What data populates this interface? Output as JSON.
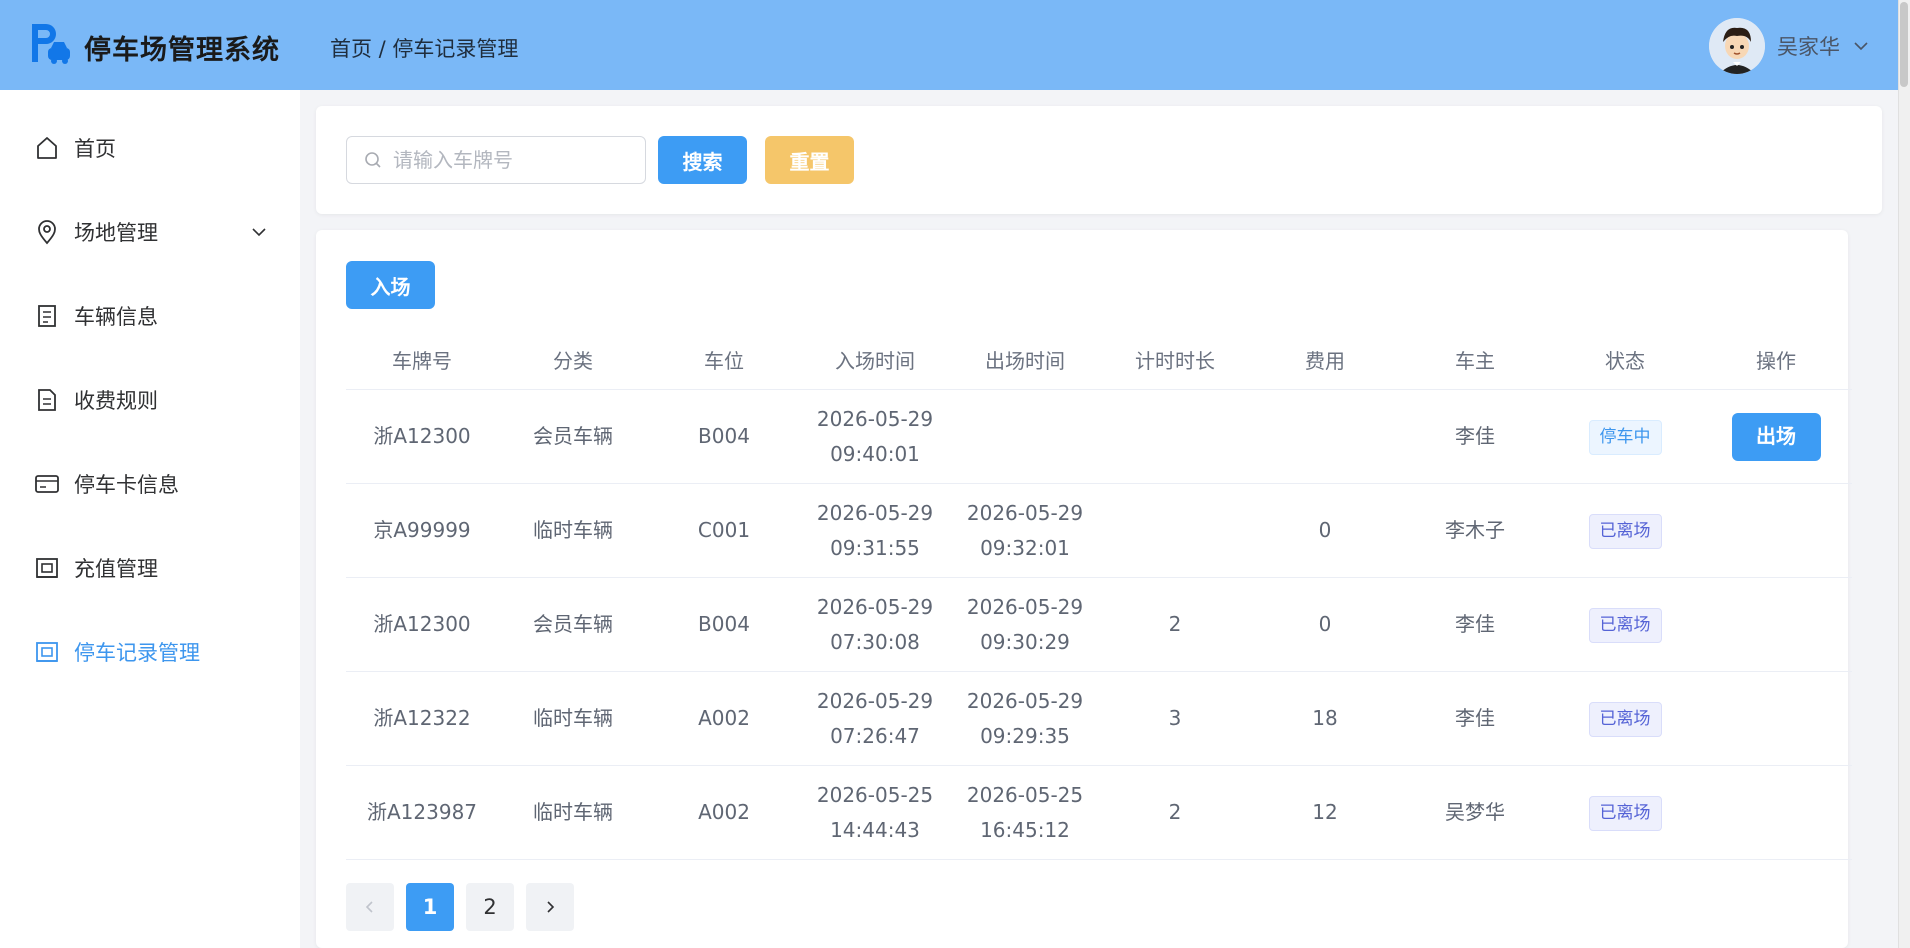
{
  "app": {
    "title": "停车场管理系统"
  },
  "breadcrumb": "首页 / 停车记录管理",
  "user": {
    "name": "吴家华"
  },
  "sidebar": {
    "items": [
      {
        "label": "首页",
        "icon": "home-icon"
      },
      {
        "label": "场地管理",
        "icon": "location-icon",
        "expandable": true
      },
      {
        "label": "车辆信息",
        "icon": "document-icon"
      },
      {
        "label": "收费规则",
        "icon": "document-icon"
      },
      {
        "label": "停车卡信息",
        "icon": "credit-card-icon"
      },
      {
        "label": "充值管理",
        "icon": "wallet-icon"
      },
      {
        "label": "停车记录管理",
        "icon": "wallet-icon",
        "active": true
      }
    ]
  },
  "search": {
    "placeholder": "请输入车牌号",
    "value": "",
    "search_label": "搜索",
    "reset_label": "重置"
  },
  "toolbar": {
    "enter_label": "入场"
  },
  "table": {
    "columns": [
      "车牌号",
      "分类",
      "车位",
      "入场时间",
      "出场时间",
      "计时时长",
      "费用",
      "车主",
      "状态",
      "操作"
    ],
    "rows": [
      {
        "plate": "浙A12300",
        "category": "会员车辆",
        "space": "B004",
        "in_date": "2026-05-29",
        "in_time": "09:40:01",
        "out_date": "",
        "out_time": "",
        "duration": "",
        "fee": "",
        "owner": "李佳",
        "status": "停车中",
        "action": "出场"
      },
      {
        "plate": "京A99999",
        "category": "临时车辆",
        "space": "C001",
        "in_date": "2026-05-29",
        "in_time": "09:31:55",
        "out_date": "2026-05-29",
        "out_time": "09:32:01",
        "duration": "",
        "fee": "0",
        "owner": "李木子",
        "status": "已离场",
        "action": ""
      },
      {
        "plate": "浙A12300",
        "category": "会员车辆",
        "space": "B004",
        "in_date": "2026-05-29",
        "in_time": "07:30:08",
        "out_date": "2026-05-29",
        "out_time": "09:30:29",
        "duration": "2",
        "fee": "0",
        "owner": "李佳",
        "status": "已离场",
        "action": ""
      },
      {
        "plate": "浙A12322",
        "category": "临时车辆",
        "space": "A002",
        "in_date": "2026-05-29",
        "in_time": "07:26:47",
        "out_date": "2026-05-29",
        "out_time": "09:29:35",
        "duration": "3",
        "fee": "18",
        "owner": "李佳",
        "status": "已离场",
        "action": ""
      },
      {
        "plate": "浙A123987",
        "category": "临时车辆",
        "space": "A002",
        "in_date": "2026-05-25",
        "in_time": "14:44:43",
        "out_date": "2026-05-25",
        "out_time": "16:45:12",
        "duration": "2",
        "fee": "12",
        "owner": "吴梦华",
        "status": "已离场",
        "action": ""
      }
    ]
  },
  "pagination": {
    "pages": [
      "1",
      "2"
    ],
    "current": "1"
  },
  "colors": {
    "header": "#7ab8f7",
    "primary": "#3d9cf4",
    "warning": "#f5c66a",
    "active_nav": "#3d96ee"
  }
}
